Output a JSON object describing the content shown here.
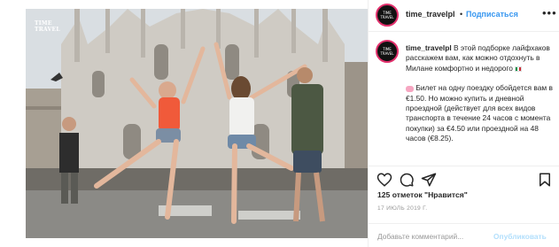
{
  "photo": {
    "watermark": "TIME TRAVEL",
    "alt_subject": "cathedral-square-with-people"
  },
  "post": {
    "username": "time_travelpl",
    "dot": "•",
    "follow_label": "Подписаться",
    "more_icon": "more-horizontal-icon",
    "avatar_text": "TIME TRAVEL"
  },
  "caption": {
    "username": "time_travelpl",
    "line1": "В этой подборке лайфхаков расскажем вам, как можно отдохнуть в Милане комфортно и недорого",
    "line2": "Билет на одну поездку обойдется вам в €1.50. Но можно купить и дневной проездной (действует для всех видов транспорта в течение 24 часов с момента покупки) за €4.50 или проездной на 48 часов (€8.25)."
  },
  "actions": {
    "icons": [
      "heart-icon",
      "comment-icon",
      "share-icon",
      "bookmark-icon"
    ]
  },
  "likes_text": "125 отметок \"Нравится\"",
  "date_text": "17 ИЮЛЬ 2019 Г.",
  "comment": {
    "placeholder": "Добавьте комментарий...",
    "publish_label": "Опубликовать"
  },
  "colors": {
    "accent": "#3897f0",
    "publish_disabled": "#b2dffc",
    "border": "#efefef",
    "muted": "#999999"
  }
}
